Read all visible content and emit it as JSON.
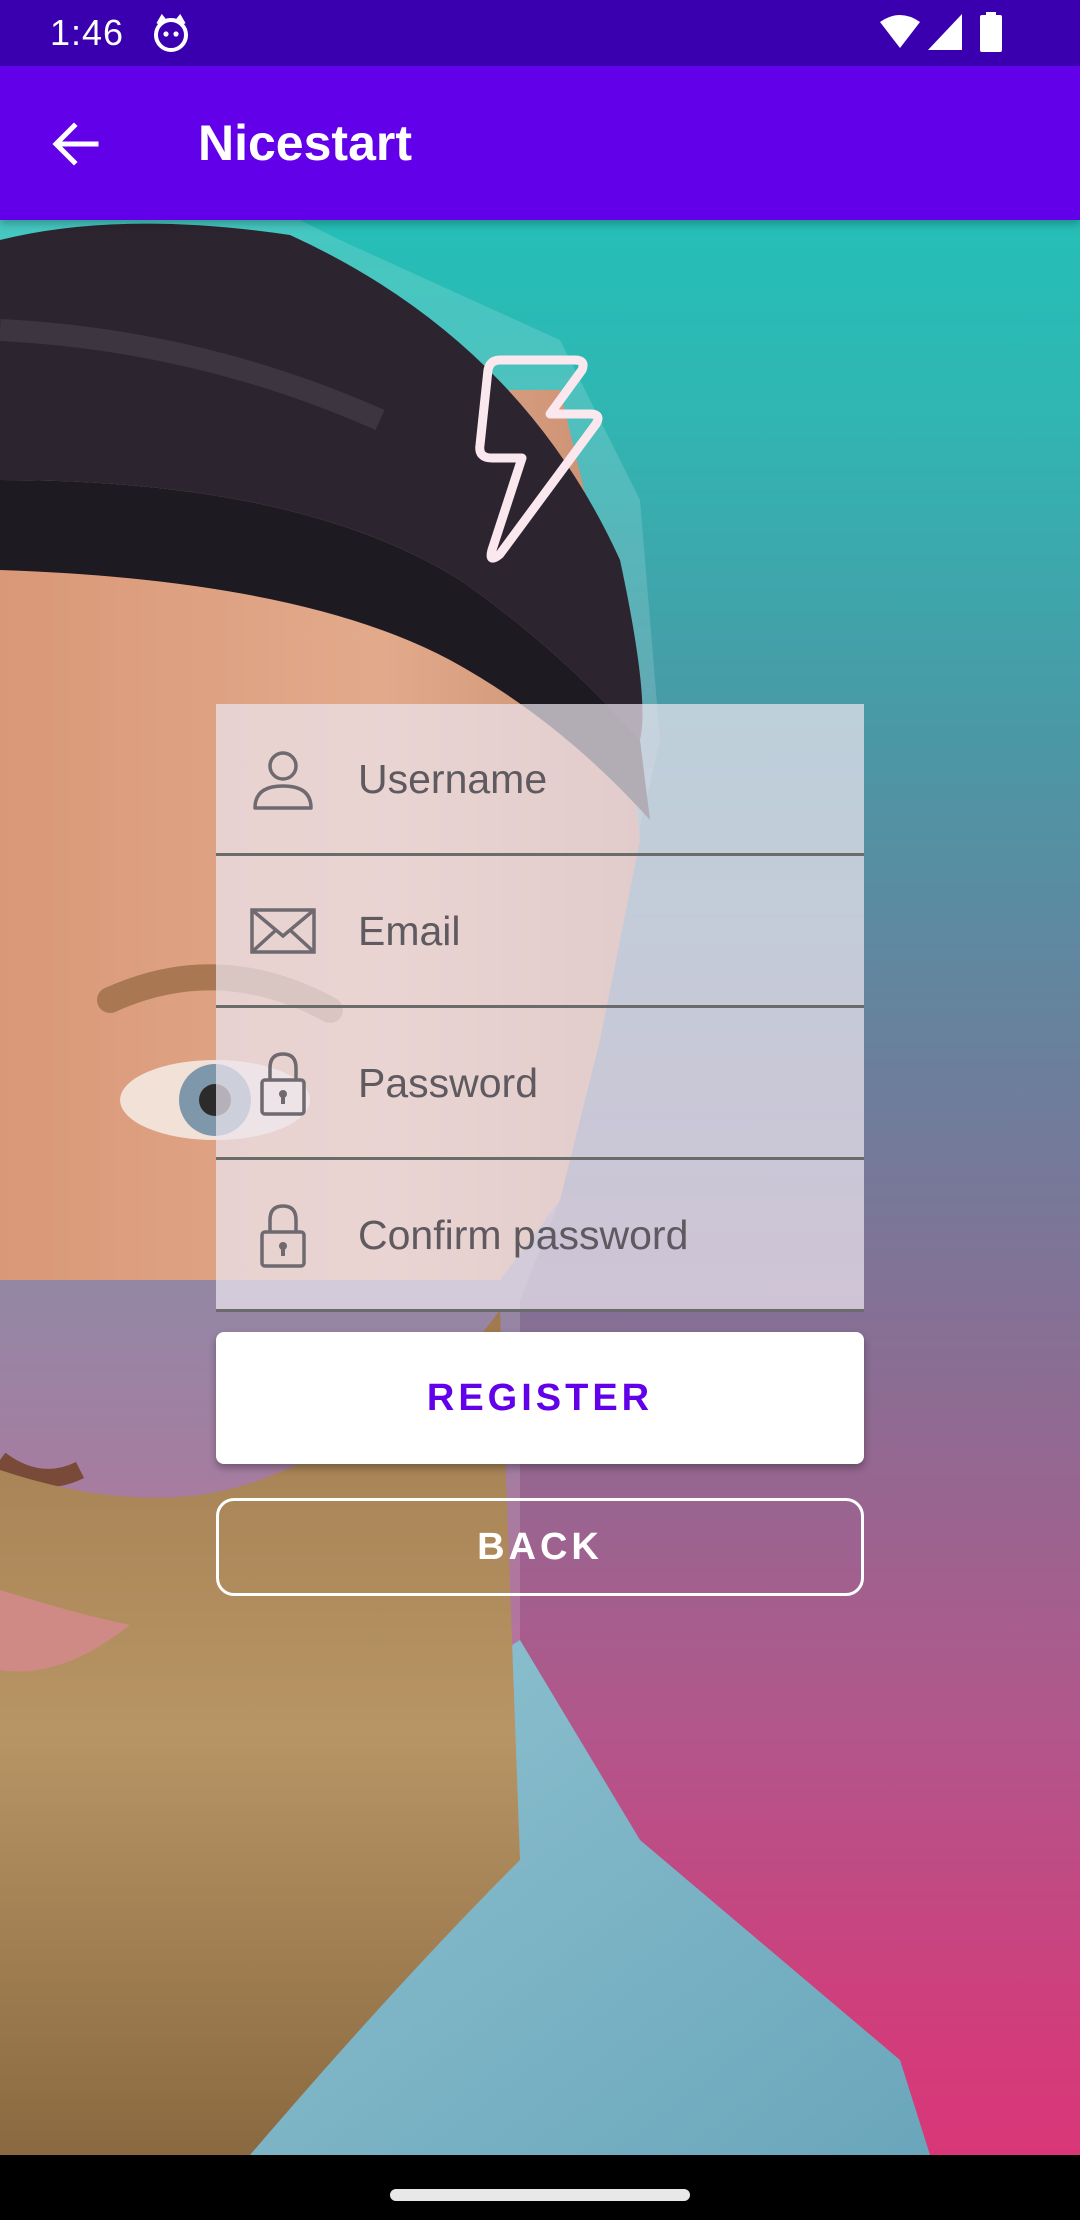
{
  "status_bar": {
    "time": "1:46",
    "icons": [
      "cat-face-icon",
      "wifi-icon",
      "signal-icon",
      "battery-icon"
    ]
  },
  "app_bar": {
    "title": "Nicestart",
    "back_icon": "arrow-left-icon",
    "color": "#6200ea"
  },
  "form": {
    "fields": [
      {
        "icon": "person-icon",
        "placeholder": "Username",
        "value": ""
      },
      {
        "icon": "envelope-icon",
        "placeholder": "Email",
        "value": ""
      },
      {
        "icon": "lock-icon",
        "placeholder": "Password",
        "value": ""
      },
      {
        "icon": "lock-icon",
        "placeholder": "Confirm password",
        "value": ""
      }
    ],
    "register_label": "REGISTER",
    "back_label": "BACK"
  },
  "colors": {
    "accent": "#6200ea",
    "status_bar": "#3a00b0",
    "gradient_top": "#18c8bd",
    "gradient_bottom": "#dd3377"
  }
}
